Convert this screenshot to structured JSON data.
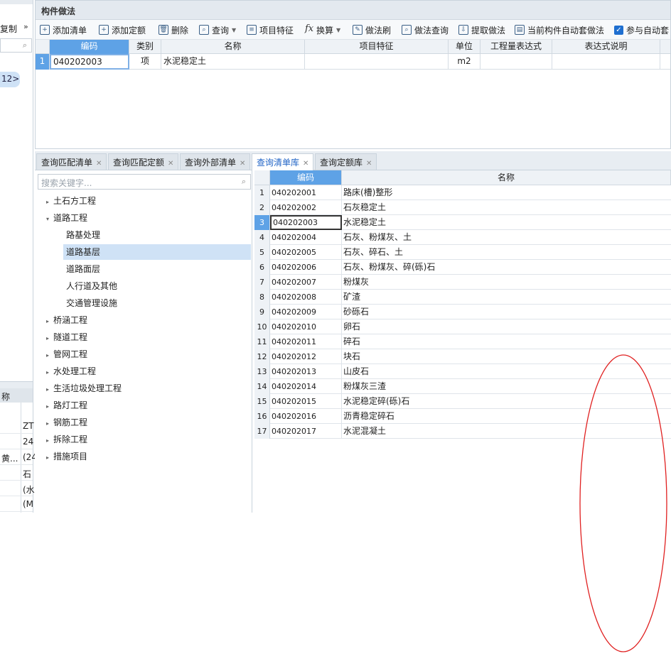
{
  "left_panel": {
    "copy_label": "复制",
    "more_glyph": "»",
    "pill_text": "12>",
    "header_cell": "称",
    "rows": [
      {
        "a": "",
        "b": "ZT"
      },
      {
        "a": "",
        "b": "24"
      },
      {
        "a": "黄...",
        "b": "(24"
      },
      {
        "a": "",
        "b": "石"
      },
      {
        "a": "",
        "b": "(水"
      },
      {
        "a": "",
        "b": "(M"
      }
    ]
  },
  "top_panel": {
    "title": "构件做法",
    "toolbar": {
      "add_list": "添加清单",
      "add_quota": "添加定额",
      "delete": "删除",
      "query": "查询",
      "item_feature": "项目特征",
      "convert": "换算",
      "method_brush": "做法刷",
      "method_query": "做法查询",
      "extract_method": "提取做法",
      "auto_method": "当前构件自动套做法",
      "participate_auto": "参与自动套"
    },
    "grid": {
      "headers": [
        "编码",
        "类别",
        "名称",
        "项目特征",
        "单位",
        "工程量表达式",
        "表达式说明"
      ],
      "row": {
        "index": "1",
        "code": "040202003",
        "type": "项",
        "name": "水泥稳定土",
        "feature": "",
        "unit": "m2",
        "expr": "",
        "expr_desc": ""
      }
    }
  },
  "tabs": [
    {
      "label": "查询匹配清单",
      "active": false
    },
    {
      "label": "查询匹配定额",
      "active": false
    },
    {
      "label": "查询外部清单",
      "active": false
    },
    {
      "label": "查询清单库",
      "active": true
    },
    {
      "label": "查询定额库",
      "active": false
    }
  ],
  "tree": {
    "search_placeholder": "搜索关键字...",
    "nodes": [
      {
        "label": "土石方工程",
        "level": 0,
        "arrow": "▸",
        "selected": false
      },
      {
        "label": "道路工程",
        "level": 0,
        "arrow": "▾",
        "selected": false
      },
      {
        "label": "路基处理",
        "level": 1,
        "arrow": "",
        "selected": false
      },
      {
        "label": "道路基层",
        "level": 1,
        "arrow": "",
        "selected": true
      },
      {
        "label": "道路面层",
        "level": 1,
        "arrow": "",
        "selected": false
      },
      {
        "label": "人行道及其他",
        "level": 1,
        "arrow": "",
        "selected": false
      },
      {
        "label": "交通管理设施",
        "level": 1,
        "arrow": "",
        "selected": false
      },
      {
        "label": "桥涵工程",
        "level": 0,
        "arrow": "▸",
        "selected": false
      },
      {
        "label": "隧道工程",
        "level": 0,
        "arrow": "▸",
        "selected": false
      },
      {
        "label": "管网工程",
        "level": 0,
        "arrow": "▸",
        "selected": false
      },
      {
        "label": "水处理工程",
        "level": 0,
        "arrow": "▸",
        "selected": false
      },
      {
        "label": "生活垃圾处理工程",
        "level": 0,
        "arrow": "▸",
        "selected": false
      },
      {
        "label": "路灯工程",
        "level": 0,
        "arrow": "▸",
        "selected": false
      },
      {
        "label": "钢筋工程",
        "level": 0,
        "arrow": "▸",
        "selected": false
      },
      {
        "label": "拆除工程",
        "level": 0,
        "arrow": "▸",
        "selected": false
      },
      {
        "label": "措施项目",
        "level": 0,
        "arrow": "▸",
        "selected": false
      }
    ]
  },
  "results": {
    "headers": {
      "code": "编码",
      "name": "名称"
    },
    "selected_index": 2,
    "rows": [
      {
        "n": "1",
        "code": "040202001",
        "name": "路床(槽)整形"
      },
      {
        "n": "2",
        "code": "040202002",
        "name": "石灰稳定土"
      },
      {
        "n": "3",
        "code": "040202003",
        "name": "水泥稳定土"
      },
      {
        "n": "4",
        "code": "040202004",
        "name": "石灰、粉煤灰、土"
      },
      {
        "n": "5",
        "code": "040202005",
        "name": "石灰、碎石、土"
      },
      {
        "n": "6",
        "code": "040202006",
        "name": "石灰、粉煤灰、碎(砾)石"
      },
      {
        "n": "7",
        "code": "040202007",
        "name": "粉煤灰"
      },
      {
        "n": "8",
        "code": "040202008",
        "name": "矿渣"
      },
      {
        "n": "9",
        "code": "040202009",
        "name": "砂砾石"
      },
      {
        "n": "10",
        "code": "040202010",
        "name": "卵石"
      },
      {
        "n": "11",
        "code": "040202011",
        "name": "碎石"
      },
      {
        "n": "12",
        "code": "040202012",
        "name": "块石"
      },
      {
        "n": "13",
        "code": "040202013",
        "name": "山皮石"
      },
      {
        "n": "14",
        "code": "040202014",
        "name": "粉煤灰三渣"
      },
      {
        "n": "15",
        "code": "040202015",
        "name": "水泥稳定碎(砾)石"
      },
      {
        "n": "16",
        "code": "040202016",
        "name": "沥青稳定碎石"
      },
      {
        "n": "17",
        "code": "040202017",
        "name": "水泥混凝土"
      }
    ]
  },
  "colors": {
    "accent": "#5ea2e6",
    "selection": "#cfe2f6",
    "annotation": "#e02020"
  }
}
